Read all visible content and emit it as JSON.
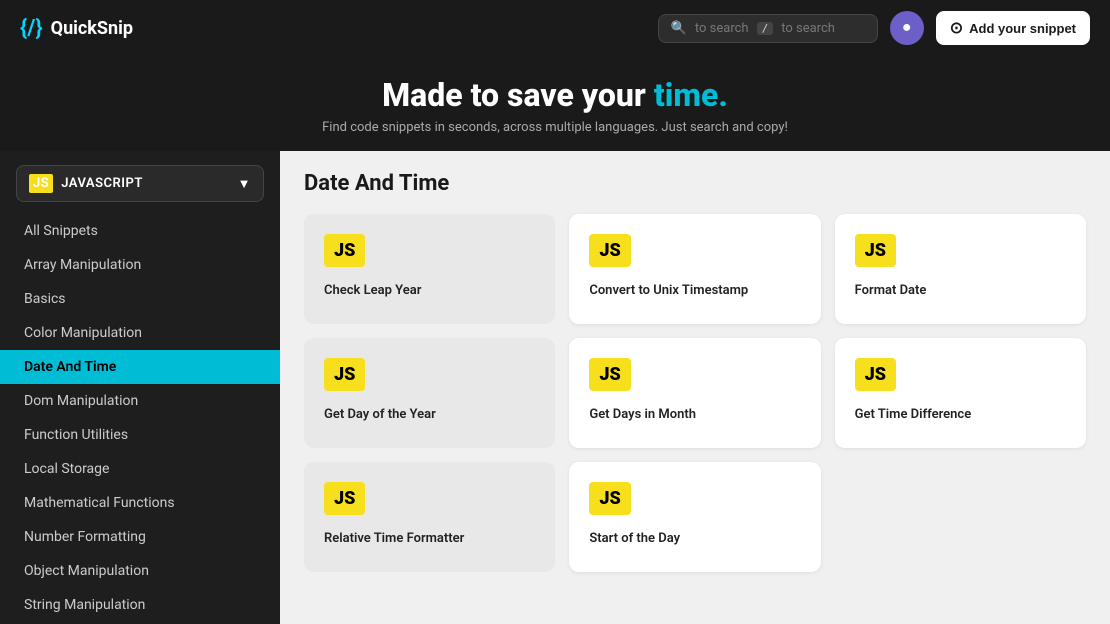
{
  "header": {
    "logo_icon": "{/}",
    "logo_text": "QuickSnip",
    "search_placeholder": "to search",
    "search_slash": "/",
    "search_icon": "🔍",
    "avatar_icon": "👤",
    "add_snippet_label": "Add your snippet",
    "github_icon": "⭕"
  },
  "hero": {
    "title_start": "Made to save your",
    "title_accent": "time.",
    "subtitle": "Find code snippets in seconds, across multiple languages. Just search and copy!"
  },
  "sidebar": {
    "lang_label": "JAVASCRIPT",
    "items": [
      {
        "id": "all-snippets",
        "label": "All Snippets",
        "active": false
      },
      {
        "id": "array-manipulation",
        "label": "Array Manipulation",
        "active": false
      },
      {
        "id": "basics",
        "label": "Basics",
        "active": false
      },
      {
        "id": "color-manipulation",
        "label": "Color Manipulation",
        "active": false
      },
      {
        "id": "date-and-time",
        "label": "Date And Time",
        "active": true
      },
      {
        "id": "dom-manipulation",
        "label": "Dom Manipulation",
        "active": false
      },
      {
        "id": "function-utilities",
        "label": "Function Utilities",
        "active": false
      },
      {
        "id": "local-storage",
        "label": "Local Storage",
        "active": false
      },
      {
        "id": "mathematical-functions",
        "label": "Mathematical Functions",
        "active": false
      },
      {
        "id": "number-formatting",
        "label": "Number Formatting",
        "active": false
      },
      {
        "id": "object-manipulation",
        "label": "Object Manipulation",
        "active": false
      },
      {
        "id": "string-manipulation",
        "label": "String Manipulation",
        "active": false
      }
    ]
  },
  "content": {
    "section_title": "Date And Time",
    "cards": [
      {
        "id": "check-leap-year",
        "label": "Check Leap Year",
        "style": "dark"
      },
      {
        "id": "convert-unix-timestamp",
        "label": "Convert to Unix Timestamp",
        "style": "light"
      },
      {
        "id": "format-date",
        "label": "Format Date",
        "style": "light"
      },
      {
        "id": "get-day-of-year",
        "label": "Get Day of the Year",
        "style": "dark"
      },
      {
        "id": "get-days-in-month",
        "label": "Get Days in Month",
        "style": "light"
      },
      {
        "id": "get-time-difference",
        "label": "Get Time Difference",
        "style": "light"
      },
      {
        "id": "relative-time-formatter",
        "label": "Relative Time Formatter",
        "style": "dark"
      },
      {
        "id": "start-of-day",
        "label": "Start of the Day",
        "style": "light"
      }
    ],
    "js_badge": "JS"
  }
}
